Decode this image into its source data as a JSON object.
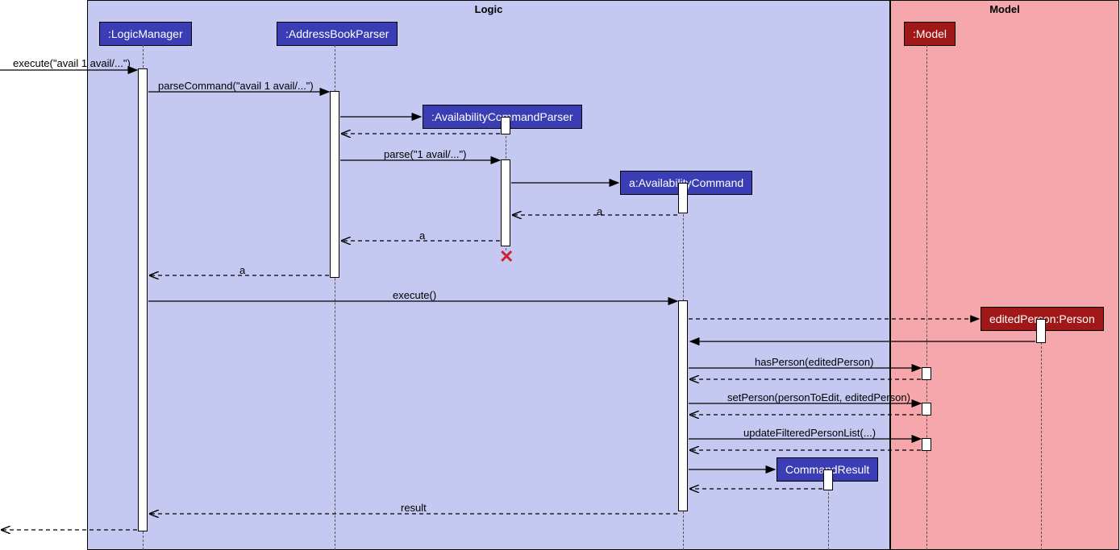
{
  "diagram": {
    "type": "uml-sequence",
    "frames": {
      "logic": "Logic",
      "model": "Model"
    },
    "participants": {
      "logicManager": ":LogicManager",
      "addressBookParser": ":AddressBookParser",
      "availabilityCommandParser": ":AvailabilityCommandParser",
      "availabilityCommand": "a:AvailabilityCommand",
      "commandResult": "CommandResult",
      "model": ":Model",
      "editedPerson": "editedPerson:Person"
    },
    "messages": {
      "externalExecute": "execute(\"avail 1 avail/...\")",
      "parseCommand": "parseCommand(\"avail 1 avail/...\")",
      "parse": "parse(\"1 avail/...\")",
      "returnA1": "a",
      "returnA2": "a",
      "returnA3": "a",
      "execute": "execute()",
      "hasPerson": "hasPerson(editedPerson)",
      "setPerson": "setPerson(personToEdit, editedPerson)",
      "updateFiltered": "updateFilteredPersonList(...)",
      "result": "result"
    }
  }
}
